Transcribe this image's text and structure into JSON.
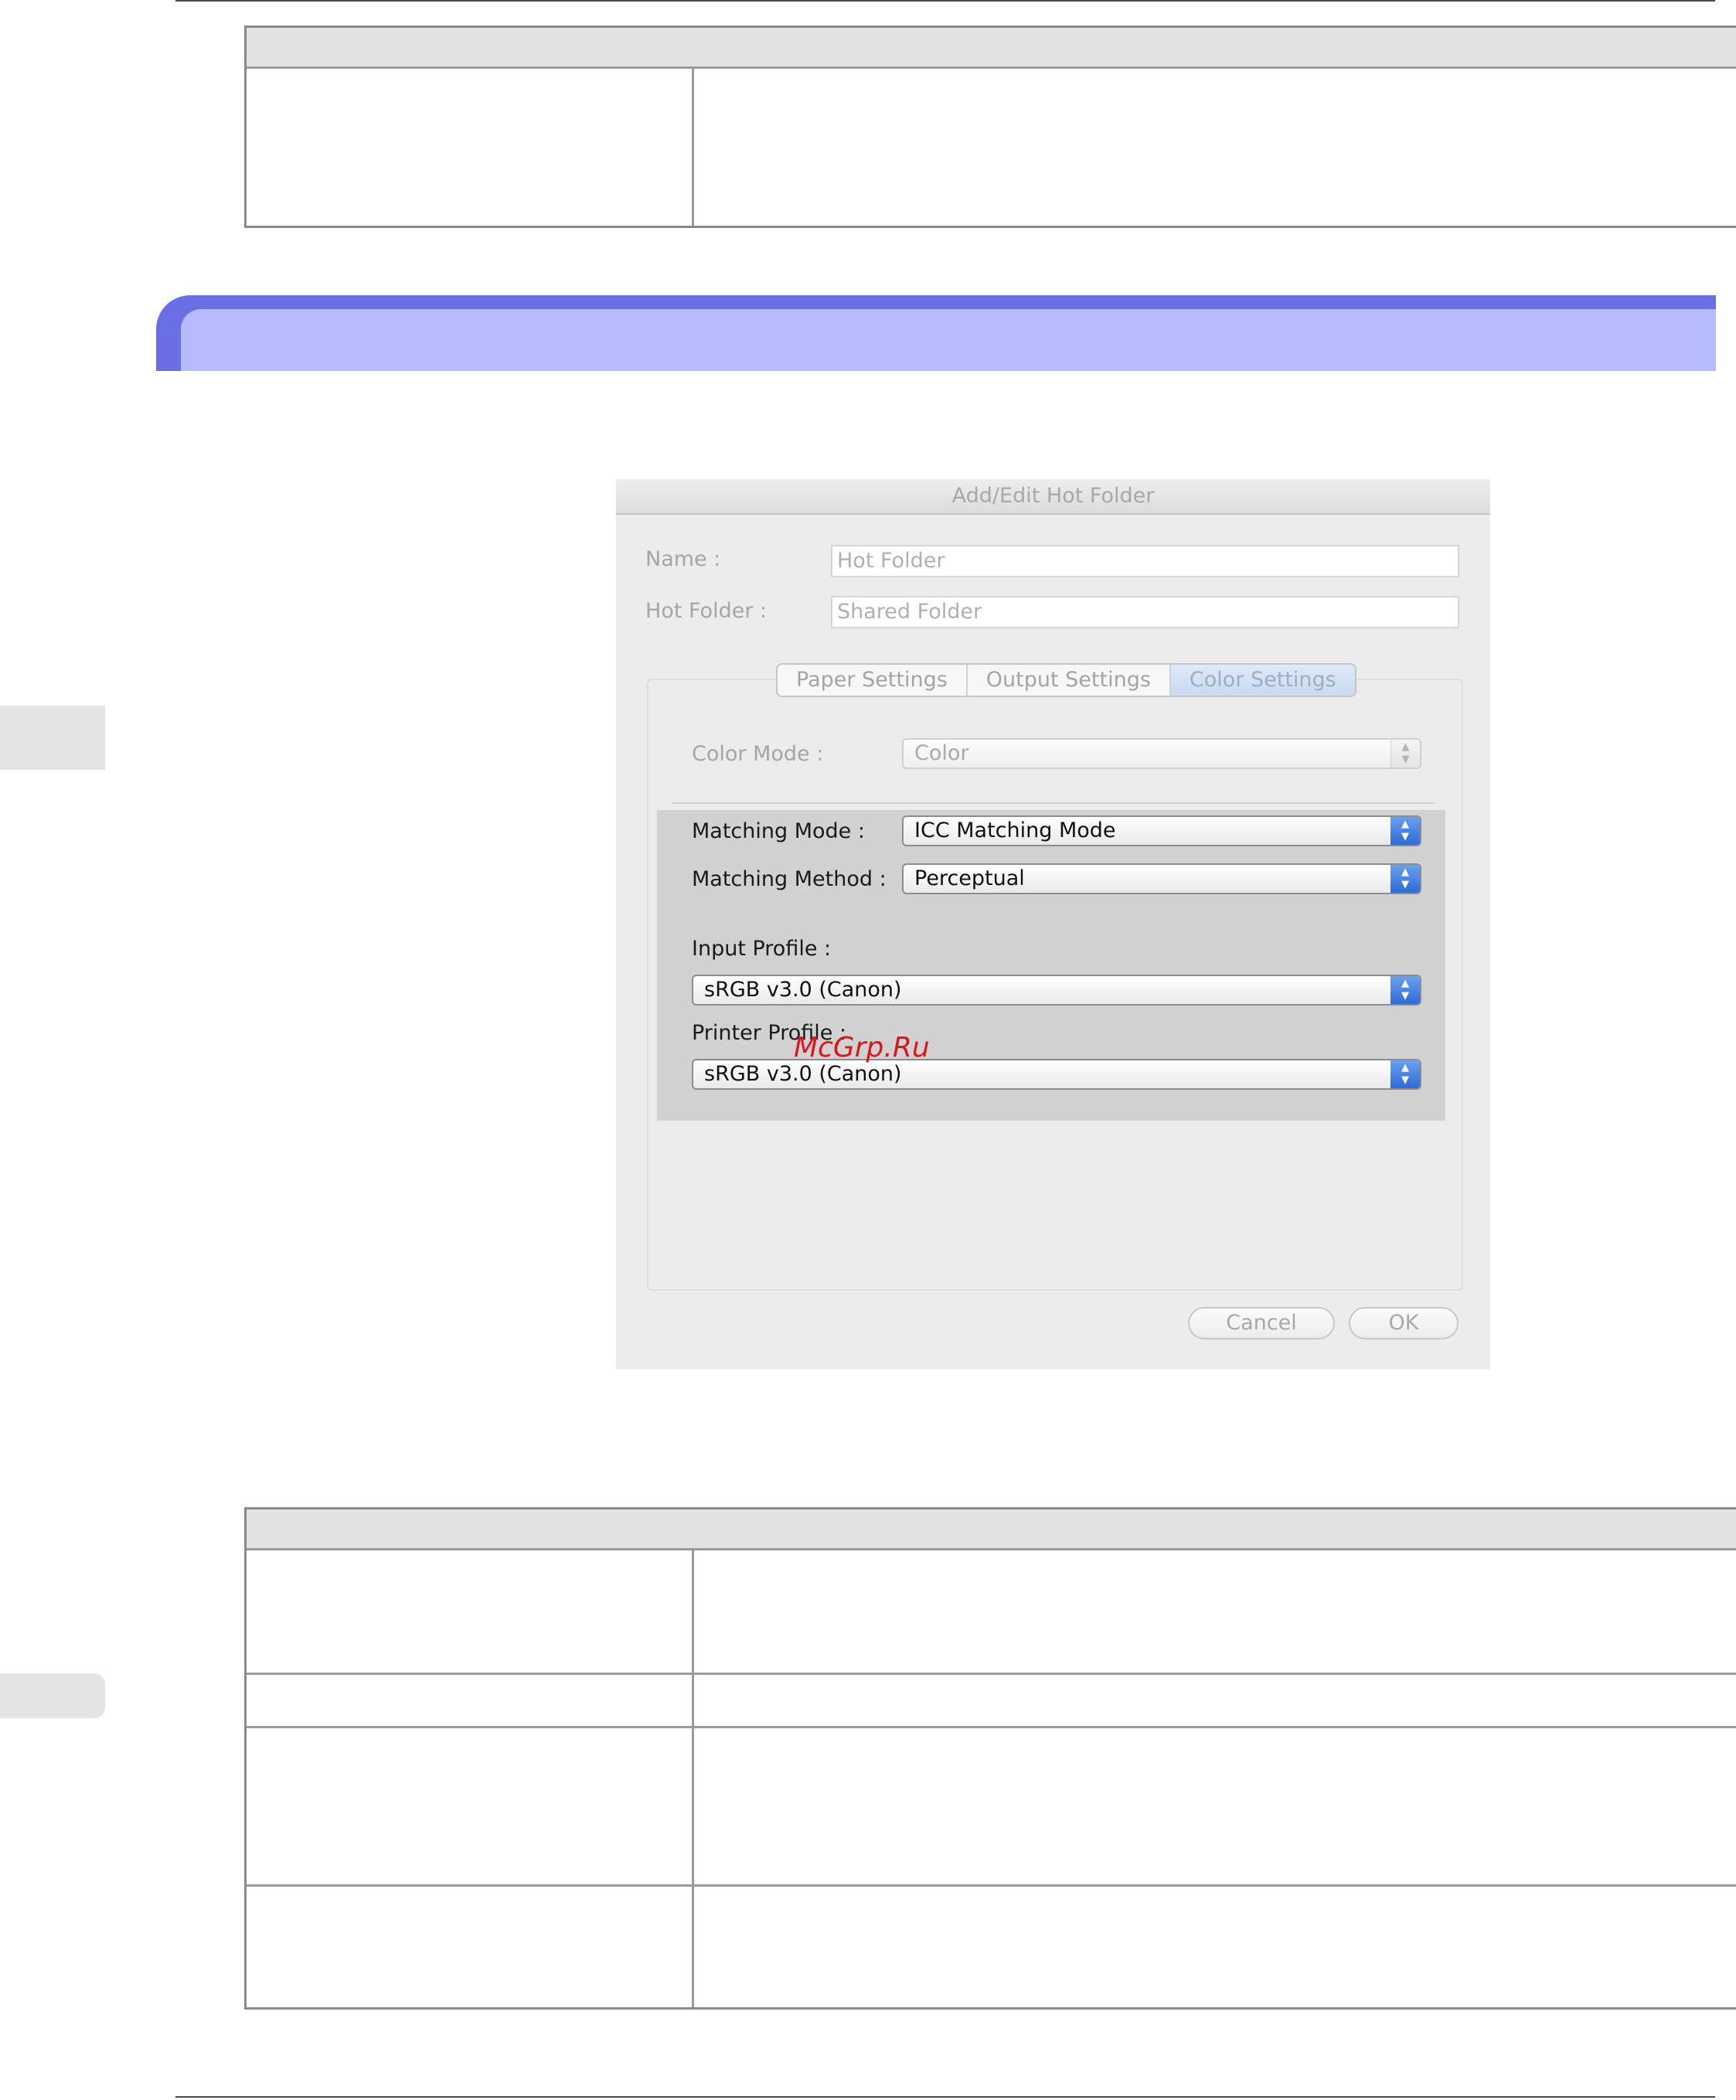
{
  "dialog": {
    "title": "Add/Edit Hot Folder",
    "name_label": "Name :",
    "name_value": "Hot Folder",
    "hot_folder_label": "Hot Folder :",
    "hot_folder_value": "Shared Folder",
    "tabs": [
      {
        "label": "Paper Settings",
        "active": false
      },
      {
        "label": "Output Settings",
        "active": false
      },
      {
        "label": "Color Settings",
        "active": true
      }
    ],
    "color_mode_label": "Color Mode :",
    "color_mode_value": "Color",
    "matching_mode_label": "Matching Mode :",
    "matching_mode_value": "ICC Matching Mode",
    "matching_method_label": "Matching Method :",
    "matching_method_value": "Perceptual",
    "input_profile_label": "Input Profile :",
    "input_profile_value": "sRGB v3.0 (Canon)",
    "printer_profile_label": "Printer Profile :",
    "printer_profile_value": "sRGB v3.0 (Canon)",
    "cancel_label": "Cancel",
    "ok_label": "OK"
  },
  "watermark": "McGrp.Ru",
  "colors": {
    "banner": "#6b6fe6",
    "banner_inner": "#b6baff",
    "stepper_active": "#2e6ad8",
    "watermark": "#d9161d"
  },
  "icons": [
    "updown-stepper-icon"
  ]
}
